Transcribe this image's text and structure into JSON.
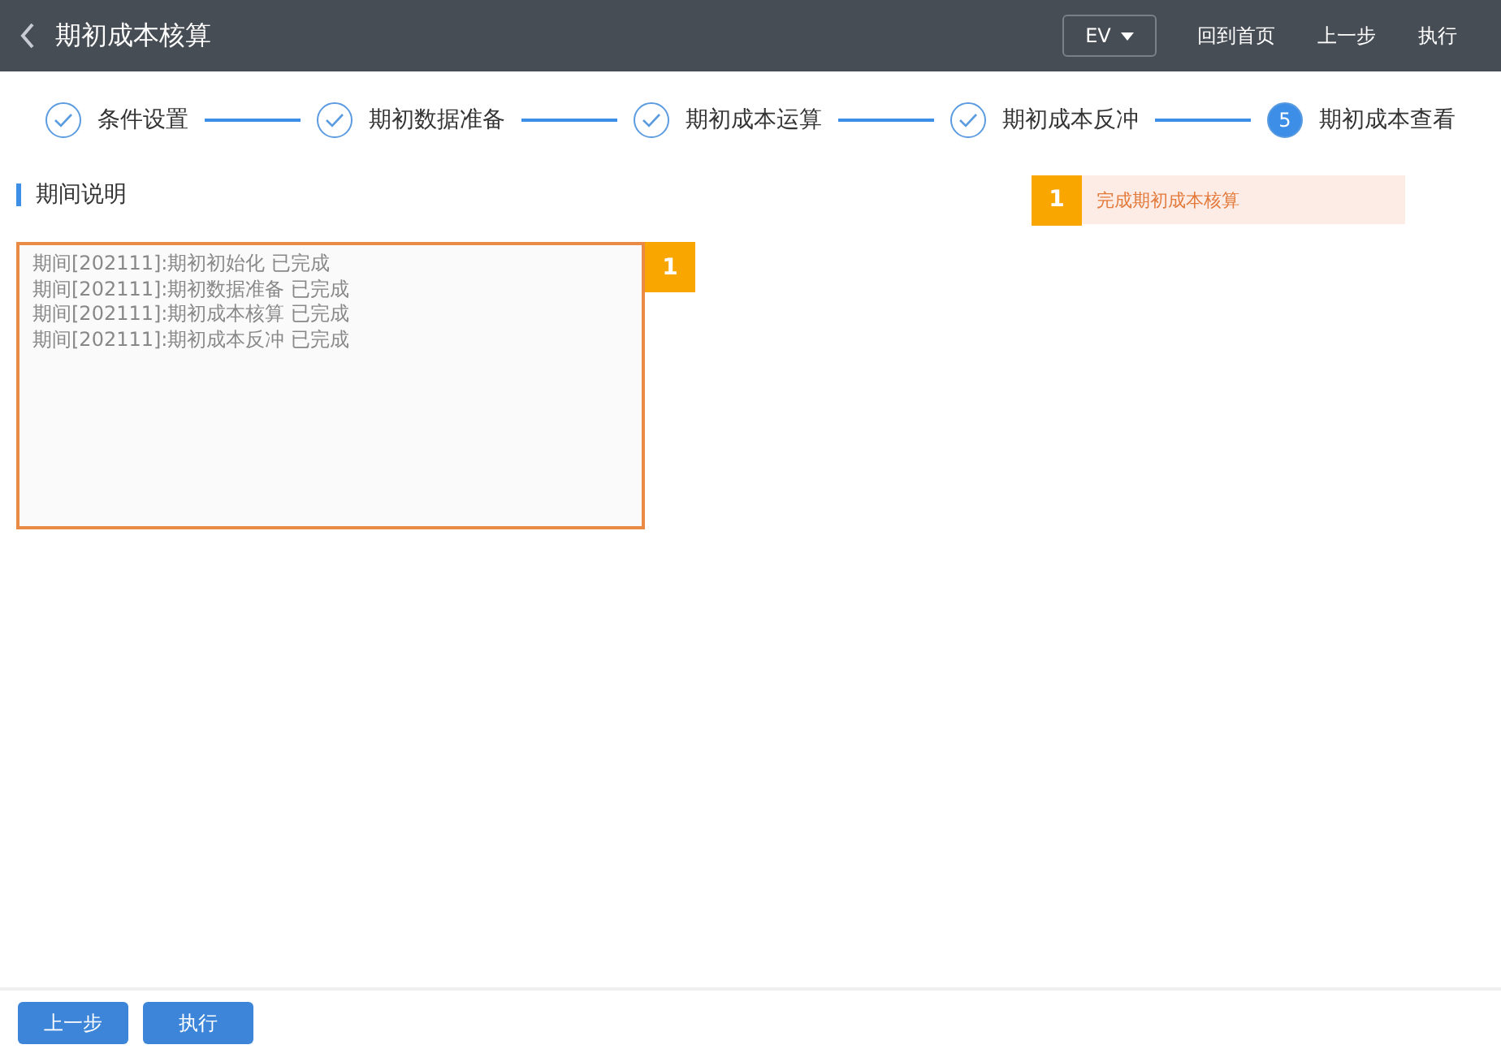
{
  "header": {
    "title": "期初成本核算",
    "language": "EV",
    "actions": [
      "回到首页",
      "上一步",
      "执行"
    ]
  },
  "steps": [
    {
      "label": "条件设置",
      "completed": true
    },
    {
      "label": "期初数据准备",
      "completed": true
    },
    {
      "label": "期初成本运算",
      "completed": true
    },
    {
      "label": "期初成本反冲",
      "completed": true
    },
    {
      "label": "期初成本查看",
      "completed": false,
      "number": "5"
    }
  ],
  "section": {
    "title": "期间说明"
  },
  "log": {
    "lines": [
      "期间[202111]:期初初始化 已完成",
      "期间[202111]:期初数据准备 已完成",
      "期间[202111]:期初成本核算 已完成",
      "期间[202111]:期初成本反冲 已完成"
    ],
    "badge": "1"
  },
  "callout": {
    "badge": "1",
    "text": "完成期初成本核算"
  },
  "footer": {
    "buttons": [
      "上一步",
      "执行"
    ]
  }
}
